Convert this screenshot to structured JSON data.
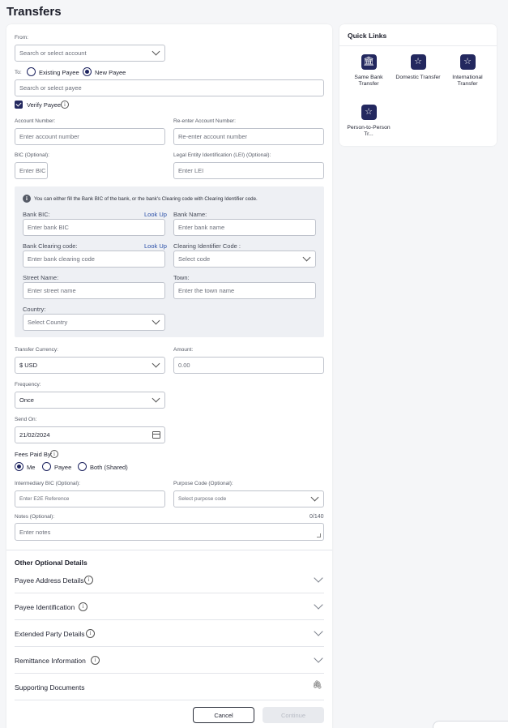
{
  "page": {
    "title": "Transfers"
  },
  "form": {
    "from": {
      "label": "From:",
      "placeholder": "Search or select account"
    },
    "to": {
      "label": "To:",
      "options": [
        "Existing Payee",
        "New Payee"
      ],
      "selected": "New Payee",
      "payee_placeholder": "Search or select payee"
    },
    "verify_payee": {
      "label": "Verify Payee",
      "checked": true
    },
    "account_number": {
      "label": "Account Number:",
      "placeholder": "Enter account number"
    },
    "reenter_account": {
      "label": "Re-enter Account Number:",
      "placeholder": "Re-enter account number"
    },
    "bic": {
      "label": "BIC (Optional):",
      "placeholder": "Enter BIC"
    },
    "lei": {
      "label": "Legal Entity Identification (LEI) (Optional):",
      "placeholder": "Enter LEI"
    },
    "bank_panel": {
      "info_text": "You can either fill the Bank BIC of the bank, or the bank's Clearing code with Clearing Identifier code.",
      "bank_bic": {
        "label": "Bank BIC:",
        "link": "Look Up",
        "placeholder": "Enter bank BIC"
      },
      "bank_name": {
        "label": "Bank Name:",
        "placeholder": "Enter bank name"
      },
      "clearing_code": {
        "label": "Bank Clearing code:",
        "link": "Look Up",
        "placeholder": "Enter bank clearing code"
      },
      "clearing_identifier": {
        "label": "Clearing Identifier Code :",
        "placeholder": "Select code"
      },
      "street": {
        "label": "Street Name:",
        "placeholder": "Enter street name"
      },
      "town": {
        "label": "Town:",
        "placeholder": "Enter the town name"
      },
      "country": {
        "label": "Country:",
        "placeholder": "Select Country"
      }
    },
    "currency": {
      "label": "Transfer Currency:",
      "value": "$ USD"
    },
    "amount": {
      "label": "Amount:",
      "placeholder": "0.00"
    },
    "frequency": {
      "label": "Frequency:",
      "value": "Once"
    },
    "send_on": {
      "label": "Send On:",
      "value": "21/02/2024"
    },
    "fees": {
      "label": "Fees Paid By:",
      "options": [
        "Me",
        "Payee",
        "Both (Shared)"
      ],
      "selected": "Me"
    },
    "intermediary_bic": {
      "label": "Intermediary BIC (Optional):",
      "placeholder": "Enter E2E Reference"
    },
    "purpose_code": {
      "label": "Purpose Code (Optional):",
      "placeholder": "Select purpose code"
    },
    "notes": {
      "label": "Notes (Optional):",
      "counter": "0/140",
      "placeholder": "Enter notes"
    },
    "other_details": {
      "title": "Other Optional Details",
      "sections": [
        "Payee Address Details",
        "Payee Identification",
        "Extended Party Details",
        "Remittance Information"
      ],
      "supporting_documents": "Supporting Documents"
    },
    "buttons": {
      "cancel": "Cancel",
      "continue": "Continue"
    }
  },
  "quick_links": {
    "title": "Quick Links",
    "items": [
      {
        "icon": "bank-icon",
        "label": "Same Bank Transfer"
      },
      {
        "icon": "star-icon",
        "label": "Domestic Transfer"
      },
      {
        "icon": "star-icon",
        "label": "International Transfer"
      },
      {
        "icon": "star-icon",
        "label": "Person-to-Person Tr..."
      }
    ]
  }
}
